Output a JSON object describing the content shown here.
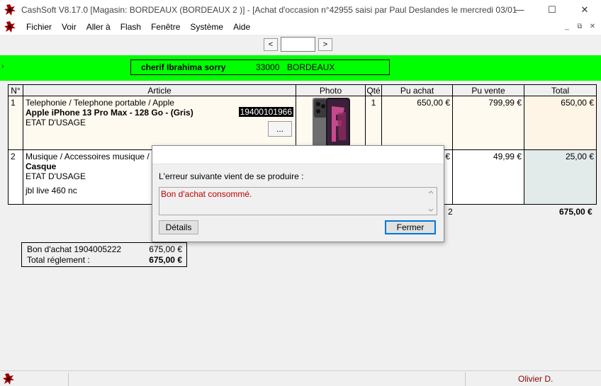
{
  "window": {
    "title": "CashSoft V8.17.0 [Magasin: BORDEAUX (BORDEAUX 2 )] - [Achat d'occasion n°42955 saisi par Paul Deslandes le mercredi 03/01...",
    "minimize": "—",
    "maximize": "☐",
    "close": "✕"
  },
  "menu": {
    "items": [
      "Fichier",
      "Voir",
      "Aller à",
      "Flash",
      "Fenêtre",
      "Système",
      "Aide"
    ],
    "mdi_minimize": "_",
    "mdi_restore": "⧉",
    "mdi_close": "✕"
  },
  "nav": {
    "prev": "<",
    "next": ">",
    "value": ""
  },
  "client": {
    "arrow": "›",
    "name": "cherif Ibrahima sorry",
    "postal_code": "33000",
    "city": "BORDEAUX"
  },
  "table": {
    "headers": [
      "N°",
      "Article",
      "Photo",
      "Qté",
      "Pu achat",
      "Pu vente",
      "Total"
    ],
    "rows": [
      {
        "num": "1",
        "category": "Telephonie / Telephone portable / Apple",
        "name": "Apple iPhone 13 Pro Max - 128 Go - (Gris)",
        "serial": "19400101966",
        "state": "ETAT D'USAGE",
        "qty": "1",
        "pu_achat": "650,00 €",
        "pu_vente": "799,99 €",
        "total": "650,00 €",
        "details_button": "..."
      },
      {
        "num": "2",
        "category": "Musique / Accessoires musique / Casque",
        "name": "Casque",
        "state": "ETAT D'USAGE",
        "note": "jbl live 460 nc",
        "pu_achat": "€",
        "pu_vente": "49,99 €",
        "total": "25,00 €"
      }
    ],
    "total_qty": "2",
    "grand_total": "675,00 €"
  },
  "reglement": {
    "bon_label": "Bon d'achat 1904005222",
    "bon_amount": "675,00 €",
    "total_label": "Total réglement :",
    "total_amount": "675,00 €"
  },
  "dialog": {
    "message": "L'erreur suivante vient de se produire :",
    "error": "Bon d'achat consommé.",
    "details_button": "Détails",
    "close_button": "Fermer"
  },
  "status": {
    "user": "Olivier D."
  },
  "colors": {
    "green_bar": "#00ff00",
    "error_text": "#c00000",
    "user_text": "#8b0000"
  }
}
